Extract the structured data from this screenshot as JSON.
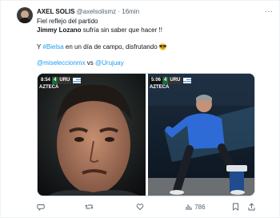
{
  "tweet": {
    "author_name": "AXEL SOLIS",
    "handle": "@axelsolismz",
    "separator": "·",
    "time": "16min",
    "more_label": "···",
    "lines": {
      "line1": "Fiel reflejo del partido",
      "line2_bold": "Jimmy Lozano",
      "line2_rest": " sufría sin saber que hacer !!",
      "line3_a": "Y ",
      "line3_hashtag": "#Bielsa",
      "line3_b": " en un día de campo, disfrutando ",
      "line3_emoji": "😎",
      "line4_mention1": "@miseleccionmx",
      "line4_vs": " vs ",
      "line4_mention2": "@Urujuay"
    },
    "media": {
      "left": {
        "clock": "8:54",
        "score": "4",
        "team": "URU",
        "network": "AZTECA"
      },
      "right": {
        "clock": "5:06",
        "score": "4",
        "team": "URU",
        "network": "AZTECA"
      }
    },
    "actions": {
      "reply_count": "",
      "retweet_count": "",
      "like_count": "",
      "views_count": "786"
    }
  },
  "colors": {
    "accent": "#1d9bf0",
    "muted": "#536471"
  }
}
